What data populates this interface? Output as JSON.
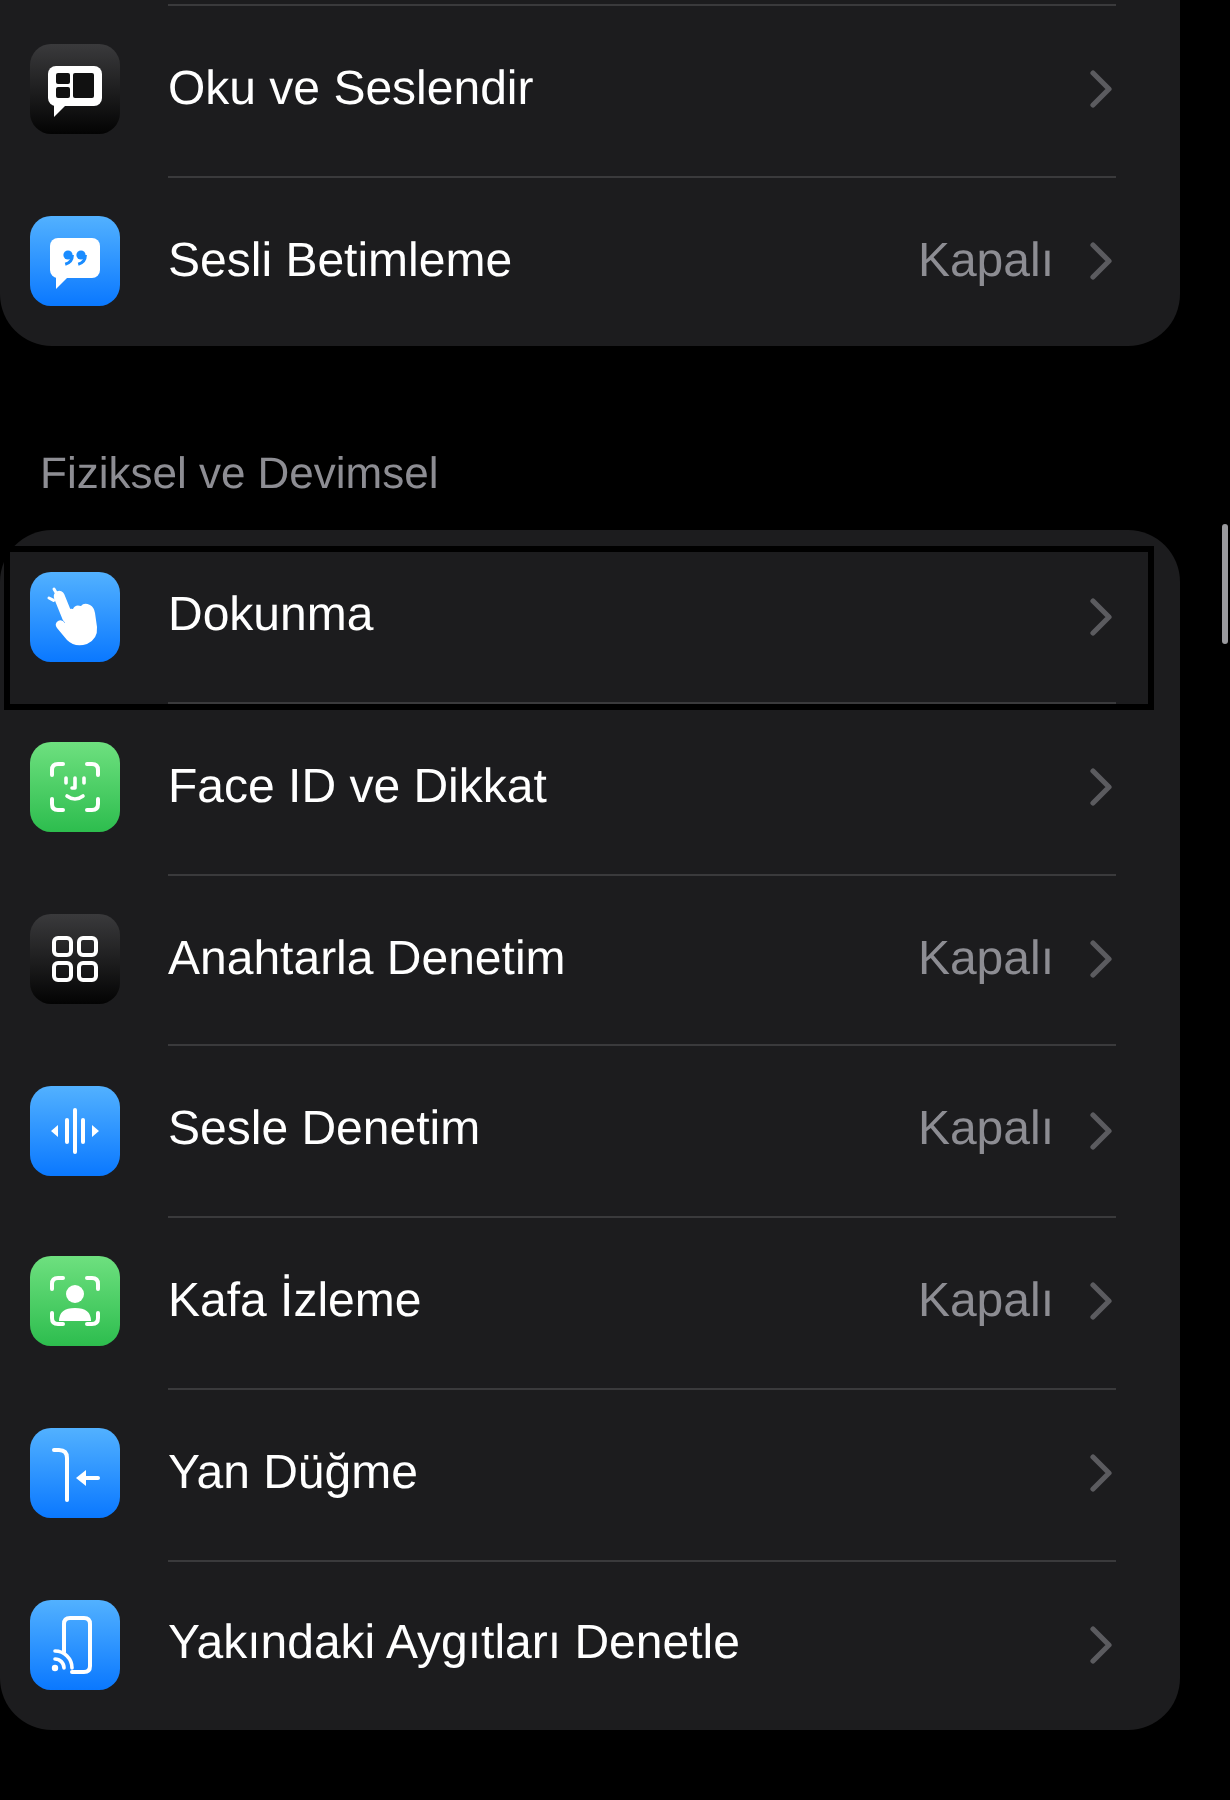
{
  "sections": [
    {
      "rows": [
        {
          "label": "Oku ve Seslendir",
          "focused": false
        },
        {
          "label": "Sesli Betimleme",
          "value": "Kapalı",
          "focused": false
        }
      ]
    },
    {
      "header": "Fiziksel ve Devimsel",
      "rows": [
        {
          "label": "Dokunma",
          "focused": true
        },
        {
          "label": "Face ID ve Dikkat",
          "focused": false
        },
        {
          "label": "Anahtarla Denetim",
          "value": "Kapalı",
          "focused": false
        },
        {
          "label": "Sesle Denetim",
          "value": "Kapalı",
          "focused": false
        },
        {
          "label": "Kafa İzleme",
          "value": "Kapalı",
          "focused": false
        },
        {
          "label": "Yan Düğme",
          "focused": false
        },
        {
          "label": "Yakındaki Aygıtları Denetle",
          "focused": false
        }
      ]
    }
  ]
}
